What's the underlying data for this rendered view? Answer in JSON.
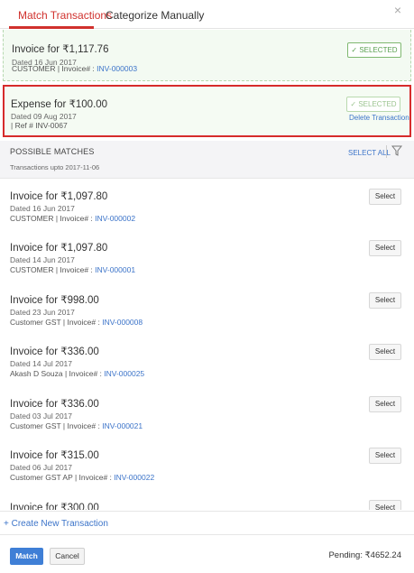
{
  "tabs": {
    "active": "Match Transactions",
    "inactive": "Categorize Manually",
    "close": "×"
  },
  "selected_items": [
    {
      "title": "Invoice  for ₹1,117.76",
      "date": "Dated 16 Jun 2017",
      "meta_prefix": "CUSTOMER | Invoice# : ",
      "meta_link": "INV-000003",
      "status": "✓  SELECTED"
    },
    {
      "title": "Expense  for ₹100.00",
      "date": "Dated 09 Aug 2017",
      "meta_prefix": "| Ref # INV-0067",
      "status": "✓  SELECTED",
      "delete": "Delete Transaction"
    }
  ],
  "possible_matches": {
    "title": "POSSIBLE MATCHES",
    "subtitle": "Transactions upto 2017-11-06",
    "select_all": "SELECT ALL",
    "select_label": "Select",
    "items": [
      {
        "title": "Invoice  for ₹1,097.80",
        "date": "Dated 16 Jun 2017",
        "meta_prefix": "CUSTOMER | Invoice# : ",
        "meta_link": "INV-000002"
      },
      {
        "title": "Invoice  for ₹1,097.80",
        "date": "Dated 14 Jun 2017",
        "meta_prefix": "CUSTOMER | Invoice# : ",
        "meta_link": "INV-000001"
      },
      {
        "title": "Invoice  for ₹998.00",
        "date": "Dated 23 Jun 2017",
        "meta_prefix": "Customer GST | Invoice# : ",
        "meta_link": "INV-000008"
      },
      {
        "title": "Invoice  for ₹336.00",
        "date": "Dated 14 Jul 2017",
        "meta_prefix": "Akash D Souza | Invoice# : ",
        "meta_link": "INV-000025"
      },
      {
        "title": "Invoice  for ₹336.00",
        "date": "Dated 03 Jul 2017",
        "meta_prefix": "Customer GST | Invoice# : ",
        "meta_link": "INV-000021"
      },
      {
        "title": "Invoice  for ₹315.00",
        "date": "Dated 06 Jul 2017",
        "meta_prefix": "Customer GST AP | Invoice# : ",
        "meta_link": "INV-000022"
      },
      {
        "title": "Invoice  for ₹300.00",
        "date": "",
        "meta_prefix": "",
        "meta_link": ""
      }
    ]
  },
  "create_link": "+ Create New Transaction",
  "footer": {
    "match": "Match",
    "cancel": "Cancel",
    "pending": "Pending: ₹4652.24"
  },
  "colors": {
    "accent_red": "#d0312d",
    "link_blue": "#3c74c9",
    "primary_button": "#3f7fd6",
    "selected_green": "#5aa050"
  }
}
